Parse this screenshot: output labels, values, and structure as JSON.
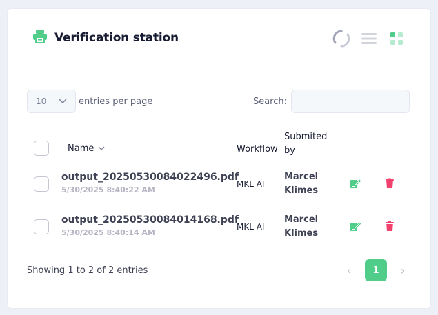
{
  "header": {
    "title": "Verification station",
    "icon": "printer-icon",
    "accent": "#50cd89"
  },
  "toolbar": {
    "icons": [
      "refresh-icon",
      "list-view-icon",
      "grid-view-icon"
    ]
  },
  "length_menu": {
    "value": "10",
    "label": "entries per page"
  },
  "search": {
    "label": "Search:",
    "value": ""
  },
  "table": {
    "columns": {
      "name": "Name",
      "workflow": "Workflow",
      "submitted_line1": "Submited",
      "submitted_line2": "by"
    },
    "rows": [
      {
        "file": "output_20250530084022496.pdf",
        "date": "5/30/2025 8:40:22 AM",
        "workflow": "MKL AI",
        "first": "Marcel",
        "last": "Klimes"
      },
      {
        "file": "output_20250530084014168.pdf",
        "date": "5/30/2025 8:40:14 AM",
        "workflow": "MKL AI",
        "first": "Marcel",
        "last": "Klimes"
      }
    ]
  },
  "footer": {
    "info": "Showing 1 to 2 of 2 entries",
    "page": "1"
  },
  "colors": {
    "success": "#50cd89",
    "danger": "#f1416c"
  }
}
